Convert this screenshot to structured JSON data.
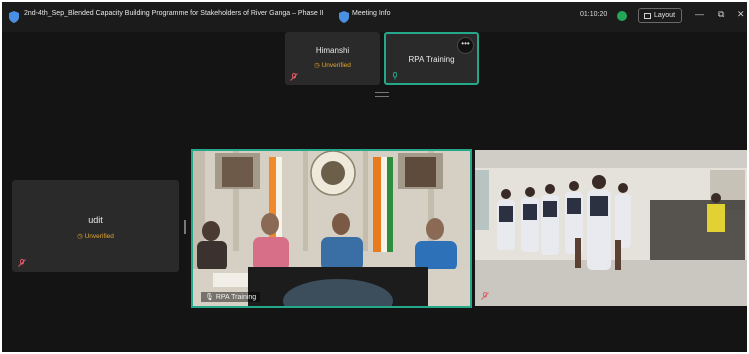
{
  "titlebar": {
    "title": "2nd-4th_Sep_Blended Capacity Building Programme for Stakeholders of River Ganga – Phase II",
    "meeting_info": "Meeting Info",
    "timer": "01:10:20",
    "layout_label": "Layout",
    "minimize": "—",
    "maximize": "⧉",
    "close": "✕"
  },
  "participants": [
    {
      "name": "Himanshi",
      "status": "Unverified"
    },
    {
      "name": "RPA Training",
      "status": ""
    },
    {
      "name": "udit",
      "status": "Unverified"
    }
  ],
  "video_main": {
    "name": "RPA Training"
  },
  "more_icon": "•••",
  "colors": {
    "accent": "#25a889",
    "warning": "#e3a62d",
    "background": "#141414",
    "tile": "#2a2a2a"
  }
}
